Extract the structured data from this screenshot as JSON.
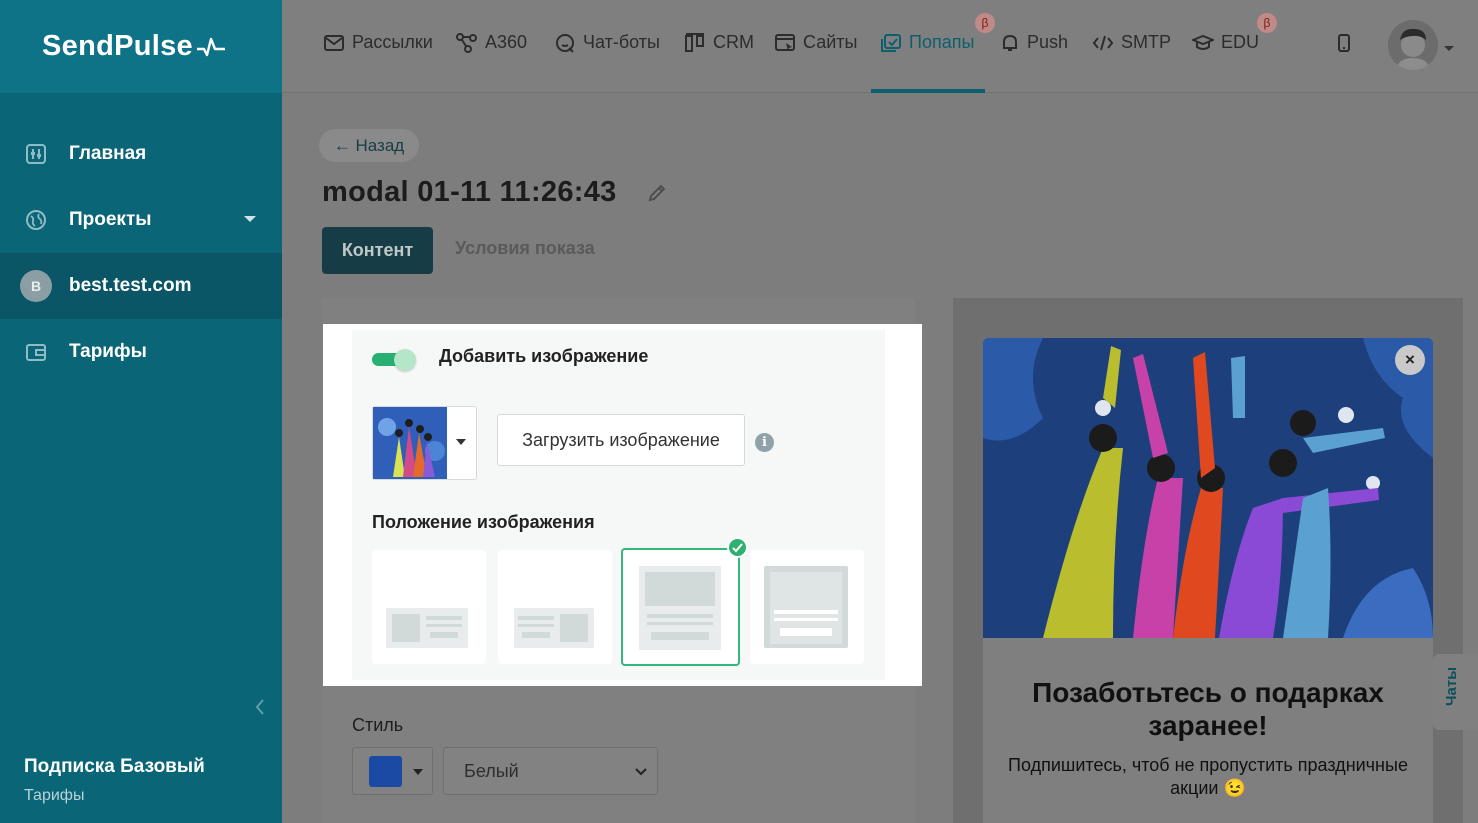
{
  "brand": {
    "logo_text": "SendPulse"
  },
  "sidebar": {
    "items": [
      {
        "label": "Главная",
        "icon": "dashboard-icon"
      },
      {
        "label": "Проекты",
        "icon": "globe-icon"
      },
      {
        "label": "best.test.com",
        "icon": "avatar-letter",
        "avatar_letter": "B"
      },
      {
        "label": "Тарифы",
        "icon": "wallet-icon"
      }
    ],
    "plan_title": "Подписка Базовый",
    "plan_link": "Тарифы"
  },
  "topnav": {
    "items": [
      {
        "label": "Рассылки",
        "icon": "mail-icon"
      },
      {
        "label": "A360",
        "icon": "workflow-icon"
      },
      {
        "label": "Чат-боты",
        "icon": "chatbot-icon"
      },
      {
        "label": "CRM",
        "icon": "crm-icon"
      },
      {
        "label": "Сайты",
        "icon": "sites-icon"
      },
      {
        "label": "Попапы",
        "icon": "popup-icon",
        "active": true,
        "beta": "β"
      },
      {
        "label": "Push",
        "icon": "bell-icon"
      },
      {
        "label": "SMTP",
        "icon": "code-icon"
      },
      {
        "label": "EDU",
        "icon": "graduation-cap-icon",
        "beta": "β"
      }
    ]
  },
  "page": {
    "back_label": "← Назад",
    "title": "modal 01-11 11:26:43",
    "tabs": [
      {
        "label": "Контент",
        "active": true
      },
      {
        "label": "Условия показа",
        "active": false
      }
    ]
  },
  "editor": {
    "add_image_label": "Добавить изображение",
    "add_image_enabled": true,
    "upload_label": "Загрузить изображение",
    "info_glyph": "i",
    "position_label": "Положение изображения",
    "position_selected_index": 2,
    "style_label": "Стиль",
    "style_color": "#1a4aa3",
    "theme_value": "Белый"
  },
  "preview": {
    "close_glyph": "×",
    "headline": "Позаботьтесь о подарках заранее!",
    "subtext": "Подпишитесь, чтоб не пропустить праздничные акции 😉"
  },
  "chat_widget": {
    "label": "Чаты"
  },
  "colors": {
    "sidebar": "#0a6577",
    "accent_green": "#2eb06f",
    "active_nav": "#0d5f6e"
  }
}
